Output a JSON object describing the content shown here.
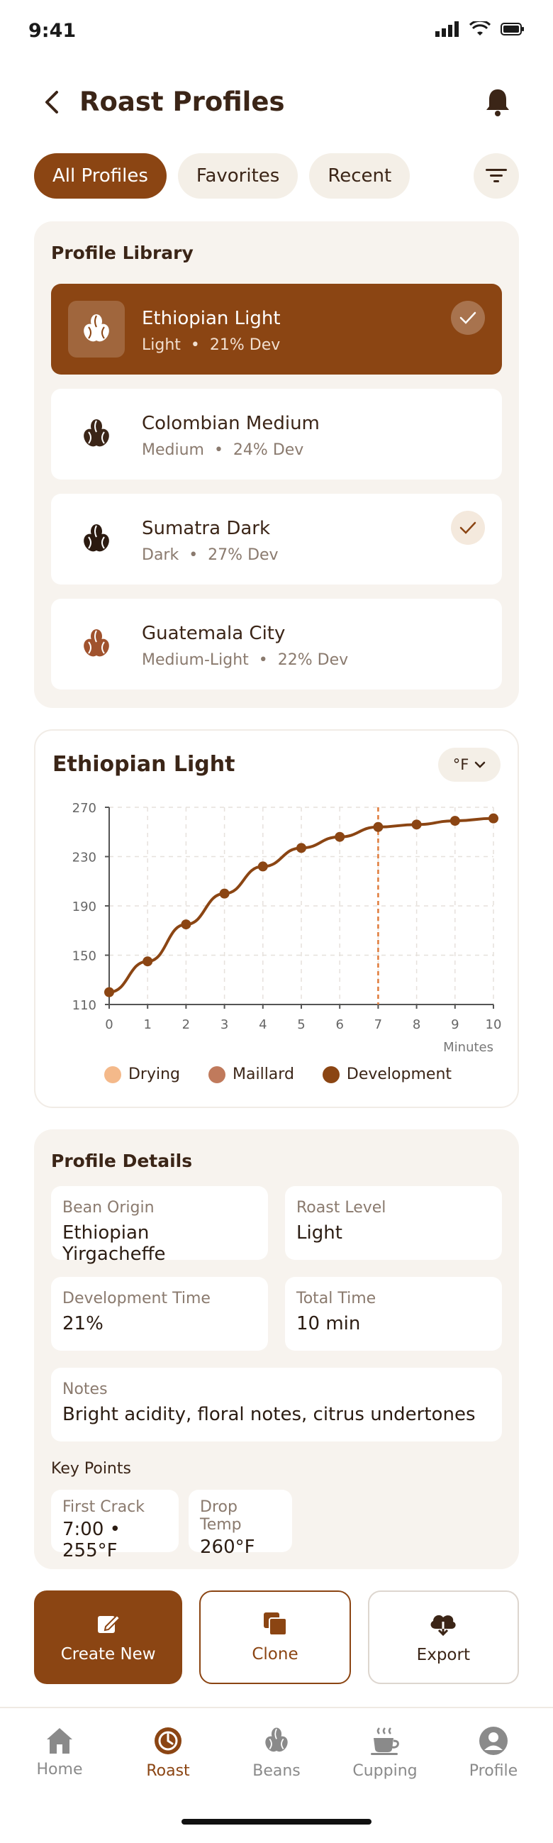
{
  "status": {
    "time": "9:41"
  },
  "header": {
    "title": "Roast Profiles"
  },
  "tabs": [
    {
      "label": "All Profiles",
      "active": true
    },
    {
      "label": "Favorites",
      "active": false
    },
    {
      "label": "Recent",
      "active": false
    }
  ],
  "library": {
    "title": "Profile Library",
    "items": [
      {
        "name": "Ethiopian Light",
        "level": "Light",
        "dev": "21% Dev",
        "selected": true,
        "checked": true
      },
      {
        "name": "Colombian Medium",
        "level": "Medium",
        "dev": "24% Dev",
        "selected": false,
        "checked": false
      },
      {
        "name": "Sumatra Dark",
        "level": "Dark",
        "dev": "27% Dev",
        "selected": false,
        "checked": true
      },
      {
        "name": "Guatemala City",
        "level": "Medium-Light",
        "dev": "22% Dev",
        "selected": false,
        "checked": false
      }
    ]
  },
  "chart": {
    "title": "Ethiopian Light",
    "unit": "°F"
  },
  "chart_data": {
    "type": "line",
    "x": [
      0,
      1,
      2,
      3,
      4,
      5,
      6,
      7,
      8,
      9,
      10
    ],
    "series": [
      {
        "values": [
          120,
          145,
          175,
          200,
          222,
          237,
          246,
          254,
          256,
          259,
          261
        ]
      }
    ],
    "xlabel": "Minutes",
    "ylabel": "",
    "xlim": [
      0,
      10
    ],
    "ylim": [
      110,
      270
    ],
    "y_ticks": [
      110,
      150,
      190,
      230,
      270
    ],
    "x_ticks": [
      0,
      1,
      2,
      3,
      4,
      5,
      6,
      7,
      8,
      9,
      10
    ],
    "marker_x": 7,
    "grid": true,
    "legend": [
      {
        "name": "Drying",
        "color": "#f4b98a"
      },
      {
        "name": "Maillard",
        "color": "#c07a5c"
      },
      {
        "name": "Development",
        "color": "#8b4513"
      }
    ],
    "line_color": "#8b4513",
    "marker_color": "#e07b3a"
  },
  "details": {
    "title": "Profile Details",
    "bean_origin_label": "Bean Origin",
    "bean_origin": "Ethiopian Yirgacheffe",
    "roast_level_label": "Roast Level",
    "roast_level": "Light",
    "dev_time_label": "Development Time",
    "dev_time": "21%",
    "total_time_label": "Total Time",
    "total_time": "10 min",
    "notes_label": "Notes",
    "notes": "Bright acidity, floral notes, citrus undertones",
    "key_points_title": "Key Points",
    "first_crack_label": "First Crack",
    "first_crack": "7:00 • 255°F",
    "drop_temp_label": "Drop Temp",
    "drop_temp": "260°F"
  },
  "actions": {
    "create": "Create New",
    "clone": "Clone",
    "export": "Export"
  },
  "nav": [
    {
      "label": "Home",
      "icon": "home-icon",
      "active": false
    },
    {
      "label": "Roast",
      "icon": "roast-icon",
      "active": true
    },
    {
      "label": "Beans",
      "icon": "beans-icon",
      "active": false
    },
    {
      "label": "Cupping",
      "icon": "cupping-icon",
      "active": false
    },
    {
      "label": "Profile",
      "icon": "profile-icon",
      "active": false
    }
  ],
  "colors": {
    "accent": "#8b4513",
    "surface": "#f7f3ee"
  }
}
